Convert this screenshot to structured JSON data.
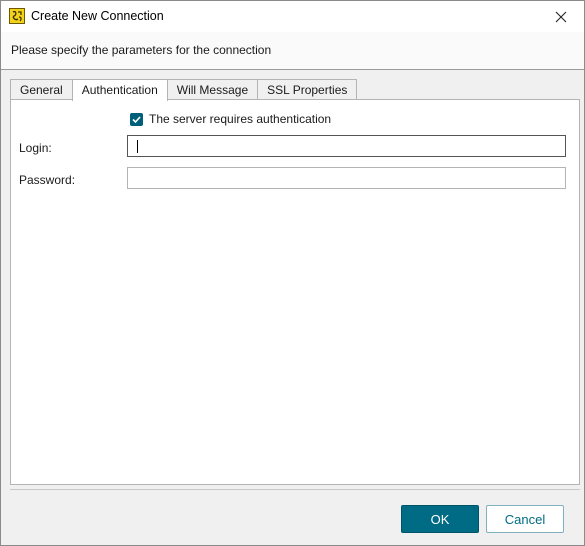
{
  "window": {
    "title": "Create New Connection",
    "subtitle": "Please specify the parameters for the connection"
  },
  "tabs": [
    {
      "label": "General",
      "active": false
    },
    {
      "label": "Authentication",
      "active": true
    },
    {
      "label": "Will Message",
      "active": false
    },
    {
      "label": "SSL Properties",
      "active": false
    }
  ],
  "auth": {
    "requires_auth_label": "The server requires authentication",
    "requires_auth_checked": true,
    "login_label": "Login:",
    "login_value": "",
    "password_label": "Password:",
    "password_value": ""
  },
  "buttons": {
    "ok": "OK",
    "cancel": "Cancel"
  },
  "icons": {
    "app": "app-logo-icon",
    "close": "close-icon",
    "check": "checkmark-icon"
  },
  "colors": {
    "accent": "#006b85",
    "checkbox": "#00607a"
  }
}
